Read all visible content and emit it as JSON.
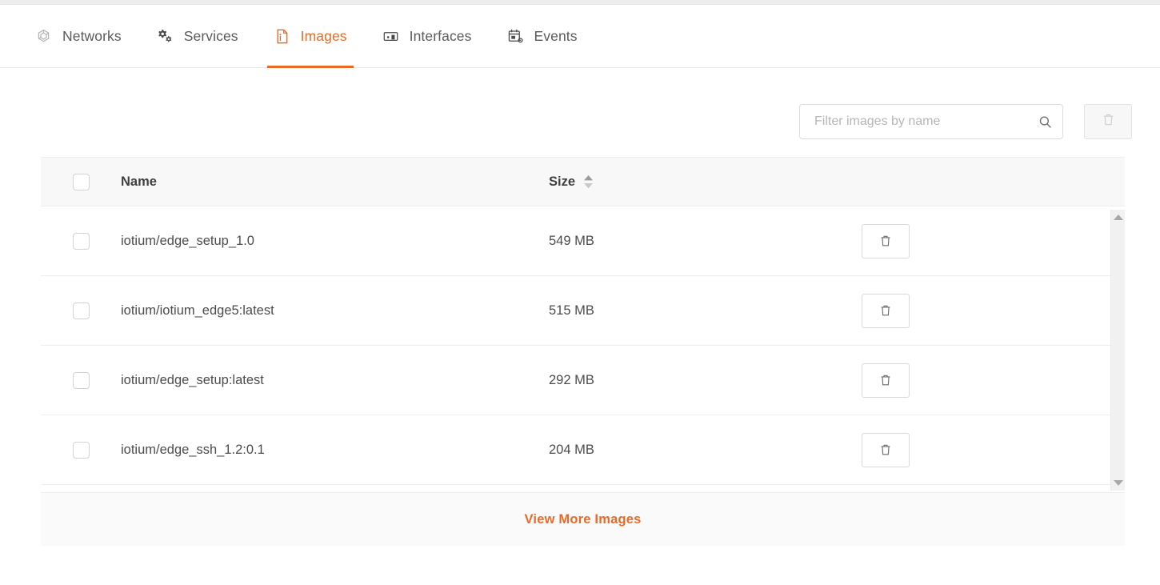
{
  "tabs": [
    {
      "label": "Networks",
      "icon": "network-nodes-icon",
      "active": false
    },
    {
      "label": "Services",
      "icon": "gears-icon",
      "active": false
    },
    {
      "label": "Images",
      "icon": "document-icon",
      "active": true
    },
    {
      "label": "Interfaces",
      "icon": "port-icon",
      "active": false
    },
    {
      "label": "Events",
      "icon": "calendar-gear-icon",
      "active": false
    }
  ],
  "toolbar": {
    "filter_placeholder": "Filter images by name",
    "filter_value": "",
    "search_icon": "search-icon",
    "delete_icon": "trash-icon",
    "delete_disabled": true
  },
  "table": {
    "columns": {
      "name": "Name",
      "size": "Size"
    },
    "sortable_column": "Size",
    "select_all_checked": false,
    "rows": [
      {
        "checked": false,
        "name": "iotium/edge_setup_1.0",
        "size": "549 MB",
        "action_icon": "trash-icon"
      },
      {
        "checked": false,
        "name": "iotium/iotium_edge5:latest",
        "size": "515 MB",
        "action_icon": "trash-icon"
      },
      {
        "checked": false,
        "name": "iotium/edge_setup:latest",
        "size": "292 MB",
        "action_icon": "trash-icon"
      },
      {
        "checked": false,
        "name": "iotium/edge_ssh_1.2:0.1",
        "size": "204 MB",
        "action_icon": "trash-icon"
      }
    ]
  },
  "footer": {
    "view_more_label": "View More Images"
  },
  "colors": {
    "accent": "#ea6a25",
    "text": "#4c4c4c",
    "muted": "#8a8a8a",
    "border": "#ededed",
    "header_bg": "#f8f8f8",
    "footer_bg": "#fafafa"
  }
}
